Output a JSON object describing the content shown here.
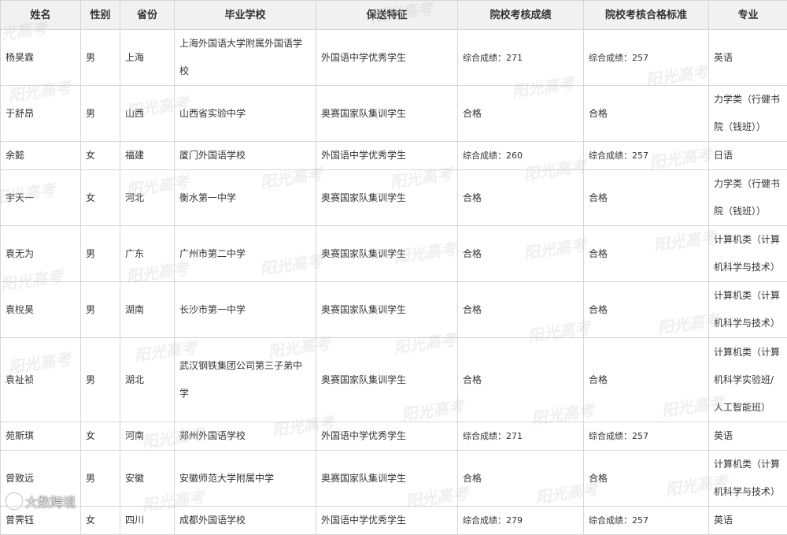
{
  "table": {
    "headers": [
      "姓名",
      "性别",
      "省份",
      "毕业学校",
      "保送特征",
      "院校考核成绩",
      "院校考核合格标准",
      "专业"
    ],
    "rows": [
      {
        "name": "杨昊霖",
        "gender": "男",
        "province": "上海",
        "school": "上海外国语大学附属外国语学校",
        "feature": "外国语中学优秀学生",
        "score": "综合成绩：271",
        "standard": "综合成绩：257",
        "major": "英语"
      },
      {
        "name": "于舒昂",
        "gender": "男",
        "province": "山西",
        "school": "山西省实验中学",
        "feature": "奥赛国家队集训学生",
        "score": "合格",
        "standard": "合格",
        "major": "力学类（行健书院（钱班））"
      },
      {
        "name": "余懿",
        "gender": "女",
        "province": "福建",
        "school": "厦门外国语学校",
        "feature": "外国语中学优秀学生",
        "score": "综合成绩：260",
        "standard": "综合成绩：257",
        "major": "日语"
      },
      {
        "name": "宇天一",
        "gender": "女",
        "province": "河北",
        "school": "衡水第一中学",
        "feature": "奥赛国家队集训学生",
        "score": "合格",
        "standard": "合格",
        "major": "力学类（行健书院（钱班））"
      },
      {
        "name": "袁无为",
        "gender": "男",
        "province": "广东",
        "school": "广州市第二中学",
        "feature": "奥赛国家队集训学生",
        "score": "合格",
        "standard": "合格",
        "major": "计算机类（计算机科学与技术）"
      },
      {
        "name": "袁梲昊",
        "gender": "男",
        "province": "湖南",
        "school": "长沙市第一中学",
        "feature": "奥赛国家队集训学生",
        "score": "合格",
        "standard": "合格",
        "major": "计算机类（计算机科学与技术）"
      },
      {
        "name": "袁祉祯",
        "gender": "男",
        "province": "湖北",
        "school": "武汉钢铁集团公司第三子弟中学",
        "feature": "奥赛国家队集训学生",
        "score": "合格",
        "standard": "合格",
        "major": "计算机类（计算机科学实验班/人工智能班）"
      },
      {
        "name": "苑斯琪",
        "gender": "女",
        "province": "河南",
        "school": "郑州外国语学校",
        "feature": "外国语中学优秀学生",
        "score": "综合成绩：271",
        "standard": "综合成绩：257",
        "major": "英语"
      },
      {
        "name": "曾致远",
        "gender": "男",
        "province": "安徽",
        "school": "安徽师范大学附属中学",
        "feature": "奥赛国家队集训学生",
        "score": "合格",
        "standard": "合格",
        "major": "计算机类（计算机科学与技术）"
      },
      {
        "name": "曾霁钰",
        "gender": "女",
        "province": "四川",
        "school": "成都外国语学校",
        "feature": "外国语中学优秀学生",
        "score": "综合成绩：279",
        "standard": "综合成绩：257",
        "major": "英语"
      }
    ]
  },
  "watermark_text": "阳光高考",
  "corner_watermark": "大数跨境"
}
